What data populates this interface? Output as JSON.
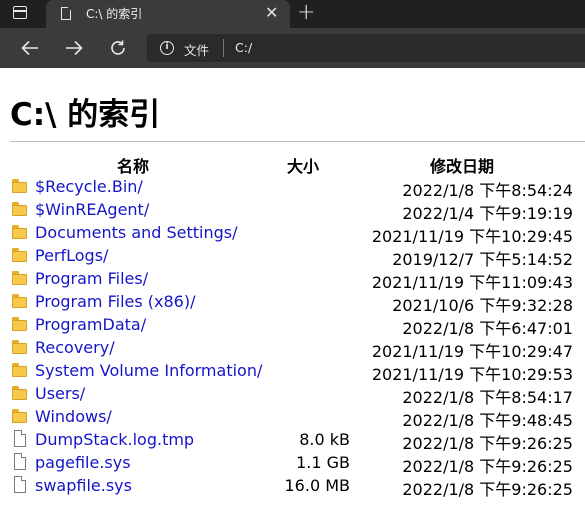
{
  "browser": {
    "tab_title": "C:\\ 的索引",
    "new_tab_glyph": "+",
    "close_glyph": "✕",
    "site_label": "文件",
    "url": "C:/"
  },
  "page": {
    "title": "C:\\ 的索引",
    "headers": {
      "name": "名称",
      "size": "大小",
      "date": "修改日期"
    },
    "entries": [
      {
        "name": "$Recycle.Bin/",
        "size": "",
        "date": "2022/1/8 下午8:54:24",
        "type": "folder"
      },
      {
        "name": "$WinREAgent/",
        "size": "",
        "date": "2022/1/4 下午9:19:19",
        "type": "folder"
      },
      {
        "name": "Documents and Settings/",
        "size": "",
        "date": "2021/11/19 下午10:29:45",
        "type": "folder"
      },
      {
        "name": "PerfLogs/",
        "size": "",
        "date": "2019/12/7 下午5:14:52",
        "type": "folder"
      },
      {
        "name": "Program Files/",
        "size": "",
        "date": "2021/11/19 下午11:09:43",
        "type": "folder"
      },
      {
        "name": "Program Files (x86)/",
        "size": "",
        "date": "2021/10/6 下午9:32:28",
        "type": "folder"
      },
      {
        "name": "ProgramData/",
        "size": "",
        "date": "2022/1/8 下午6:47:01",
        "type": "folder"
      },
      {
        "name": "Recovery/",
        "size": "",
        "date": "2021/11/19 下午10:29:47",
        "type": "folder"
      },
      {
        "name": "System Volume Information/",
        "size": "",
        "date": "2021/11/19 下午10:29:53",
        "type": "folder"
      },
      {
        "name": "Users/",
        "size": "",
        "date": "2022/1/8 下午8:54:17",
        "type": "folder"
      },
      {
        "name": "Windows/",
        "size": "",
        "date": "2022/1/8 下午9:48:45",
        "type": "folder"
      },
      {
        "name": "DumpStack.log.tmp",
        "size": "8.0 kB",
        "date": "2022/1/8 下午9:26:25",
        "type": "file"
      },
      {
        "name": "pagefile.sys",
        "size": "1.1 GB",
        "date": "2022/1/8 下午9:26:25",
        "type": "file"
      },
      {
        "name": "swapfile.sys",
        "size": "16.0 MB",
        "date": "2022/1/8 下午9:26:25",
        "type": "file"
      }
    ]
  },
  "icons": {
    "folder": "folder-icon",
    "file": "file-icon"
  },
  "colors": {
    "link": "#1515c8",
    "chrome_dark": "#202020",
    "chrome_toolbar": "#3b3b3b"
  }
}
